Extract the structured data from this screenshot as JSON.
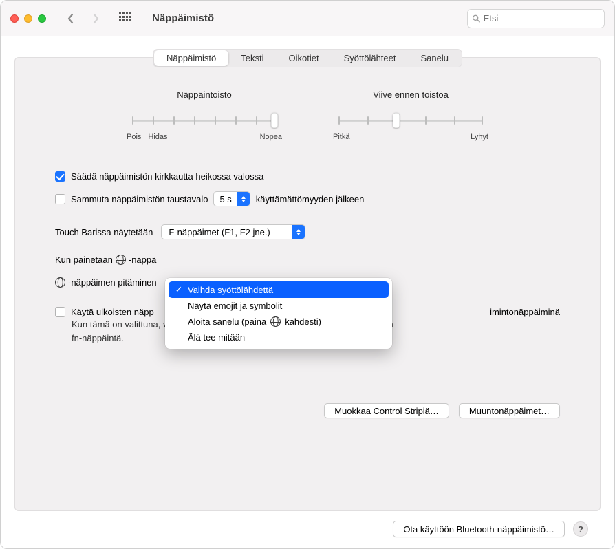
{
  "window": {
    "title": "Näppäimistö"
  },
  "search": {
    "placeholder": "Etsi"
  },
  "tabs": {
    "items": [
      {
        "label": "Näppäimistö",
        "active": true
      },
      {
        "label": "Teksti"
      },
      {
        "label": "Oikotiet"
      },
      {
        "label": "Syöttölähteet"
      },
      {
        "label": "Sanelu"
      }
    ]
  },
  "sliders": {
    "repeat": {
      "title": "Näppäintoisto",
      "left1": "Pois",
      "left2": "Hidas",
      "right": "Nopea",
      "ticks": 8,
      "value_index": 7
    },
    "delay": {
      "title": "Viive ennen toistoa",
      "left": "Pitkä",
      "right": "Lyhyt",
      "ticks": 6,
      "value_index": 2
    }
  },
  "brightness": {
    "checkbox_label": "Säädä näppäimistön kirkkautta heikossa valossa",
    "checked": true
  },
  "backlight": {
    "checkbox_label": "Sammuta näppäimistön taustavalo",
    "checked": false,
    "select_value": "5 s",
    "suffix": "käyttämättömyyden jälkeen"
  },
  "touchbar": {
    "label": "Touch Barissa näytetään",
    "select_value": "F-näppäimet (F1, F2 jne.)"
  },
  "globe_press": {
    "prefix": "Kun painetaan ",
    "suffix_truncated": "-näppä",
    "second_line_prefix_truncated": "-näppäimen pitäminen"
  },
  "dropdown": {
    "items": [
      {
        "label": "Vaihda syöttölähdettä",
        "selected": true
      },
      {
        "label": "Näytä emojit ja symbolit"
      },
      {
        "label_pre": "Aloita sanelu (paina ",
        "label_post": " kahdesti)",
        "has_globe": true
      },
      {
        "label": "Älä tee mitään"
      }
    ]
  },
  "fn_block": {
    "checkbox_label_prefix": "Käytä ulkoisten näpp",
    "checkbox_label_suffix": "imintonäppäiminä",
    "checked": false,
    "desc_line1": "Kun tämä on valittuna, voit käyttää näppäimien erikoistoimintoja painamalla ensin",
    "desc_line2": "fn-näppäintä."
  },
  "buttons": {
    "control_strip": "Muokkaa Control Stripiä…",
    "modifier": "Muuntonäppäimet…",
    "bluetooth": "Ota käyttöön Bluetooth-näppäimistö…"
  },
  "help": "?"
}
